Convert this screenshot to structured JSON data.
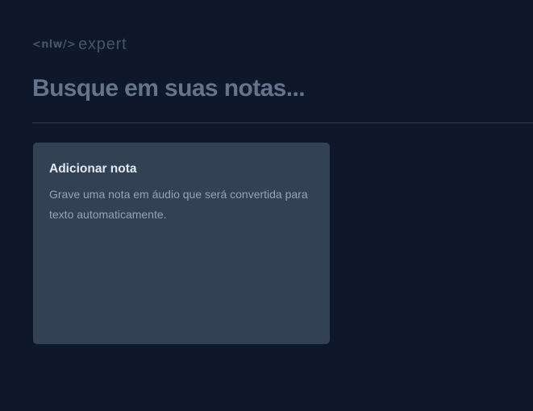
{
  "logo": {
    "prefix": "<nlw/>",
    "name": "expert"
  },
  "search": {
    "placeholder": "Busque em suas notas..."
  },
  "add_note_card": {
    "title": "Adicionar nota",
    "description": "Grave uma nota em áudio que será convertida para texto automaticamente."
  },
  "colors": {
    "background": "#0f172a",
    "card": "#334155",
    "divider": "#334155",
    "logo": "#475569",
    "placeholder": "#64748b"
  }
}
